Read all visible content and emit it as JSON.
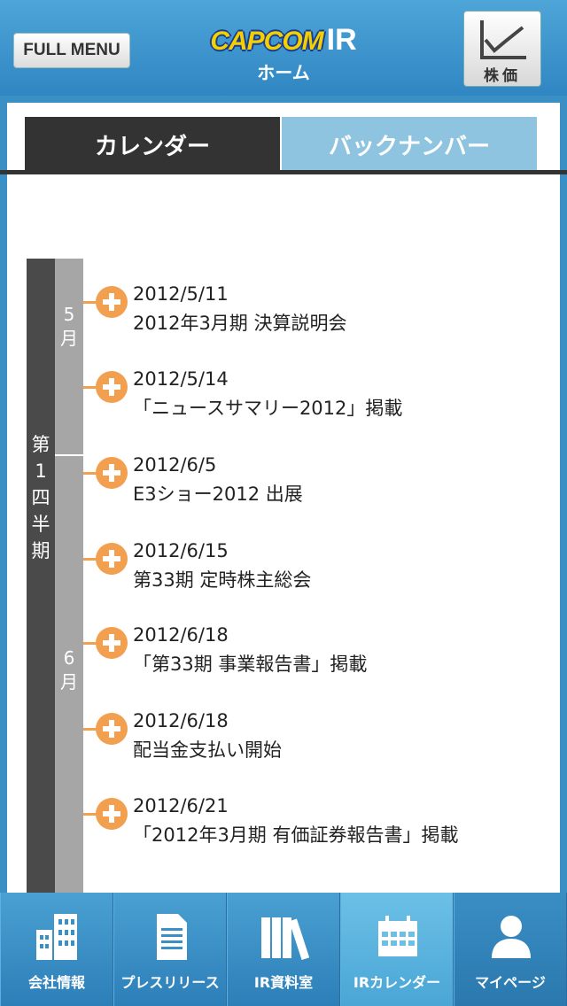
{
  "header": {
    "full_menu_label": "FULL MENU",
    "logo_brand": "CAPCOM",
    "logo_suffix": "IR",
    "home_label": "ホーム",
    "stock_label": "株価"
  },
  "tabs": [
    {
      "label": "カレンダー",
      "active": true
    },
    {
      "label": "バックナンバー",
      "active": false
    }
  ],
  "timeline": {
    "quarter_label": "第1四半期",
    "months": [
      "5月",
      "6月"
    ],
    "events": [
      {
        "date": "2012/5/11",
        "title": "2012年3月期 決算説明会"
      },
      {
        "date": "2012/5/14",
        "title": "「ニュースサマリー2012」掲載"
      },
      {
        "date": "2012/6/5",
        "title": "E3ショー2012 出展"
      },
      {
        "date": "2012/6/15",
        "title": "第33期 定時株主総会"
      },
      {
        "date": "2012/6/18",
        "title": "「第33期 事業報告書」掲載"
      },
      {
        "date": "2012/6/18",
        "title": "配当金支払い開始"
      },
      {
        "date": "2012/6/21",
        "title": "「2012年3月期 有価証券報告書」掲載"
      }
    ]
  },
  "bottom_nav": [
    {
      "label": "会社情報",
      "icon": "building-icon"
    },
    {
      "label": "プレスリリース",
      "icon": "document-icon"
    },
    {
      "label": "IR資料室",
      "icon": "books-icon"
    },
    {
      "label": "IRカレンダー",
      "icon": "calendar-icon",
      "selected": true
    },
    {
      "label": "マイページ",
      "icon": "person-icon"
    }
  ],
  "colors": {
    "accent_orange": "#f2a050",
    "header_blue": "#3a8fc4",
    "tab_dark": "#333333",
    "tab_light": "#8ec4e0"
  }
}
